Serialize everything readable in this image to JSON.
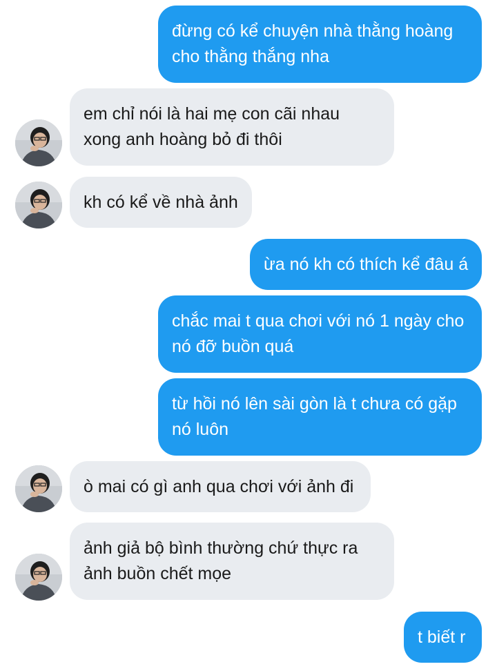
{
  "colors": {
    "outgoing_bubble": "#1f9bf0",
    "incoming_bubble": "#e9ecf0",
    "background": "#ffffff"
  },
  "messages": [
    {
      "direction": "out",
      "lines": [
        "đừng có kể chuyện nhà thằng hoàng",
        "cho thằng thắng nha"
      ]
    },
    {
      "direction": "in",
      "avatar": "profile-photo",
      "lines": [
        "em chỉ nói là hai mẹ con cãi nhau",
        "xong anh hoàng bỏ đi thôi"
      ]
    },
    {
      "direction": "in",
      "avatar": "profile-photo",
      "lines": [
        "kh có kể về nhà ảnh"
      ]
    },
    {
      "direction": "out",
      "lines": [
        "ừa nó kh có thích kể đâu á"
      ]
    },
    {
      "direction": "out",
      "lines": [
        "chắc mai t qua chơi với nó 1 ngày cho",
        "nó đỡ buồn quá"
      ]
    },
    {
      "direction": "out",
      "lines": [
        "từ hồi nó lên sài gòn là t chưa có gặp",
        "nó luôn"
      ]
    },
    {
      "direction": "in",
      "avatar": "profile-photo",
      "lines": [
        "ò mai có gì anh qua chơi với ảnh đi"
      ]
    },
    {
      "direction": "in",
      "avatar": "profile-photo",
      "lines": [
        "ảnh giả bộ bình thường chứ thực ra",
        "ảnh buồn chết mọe"
      ]
    },
    {
      "direction": "out",
      "lines": [
        "t biết r"
      ]
    }
  ]
}
